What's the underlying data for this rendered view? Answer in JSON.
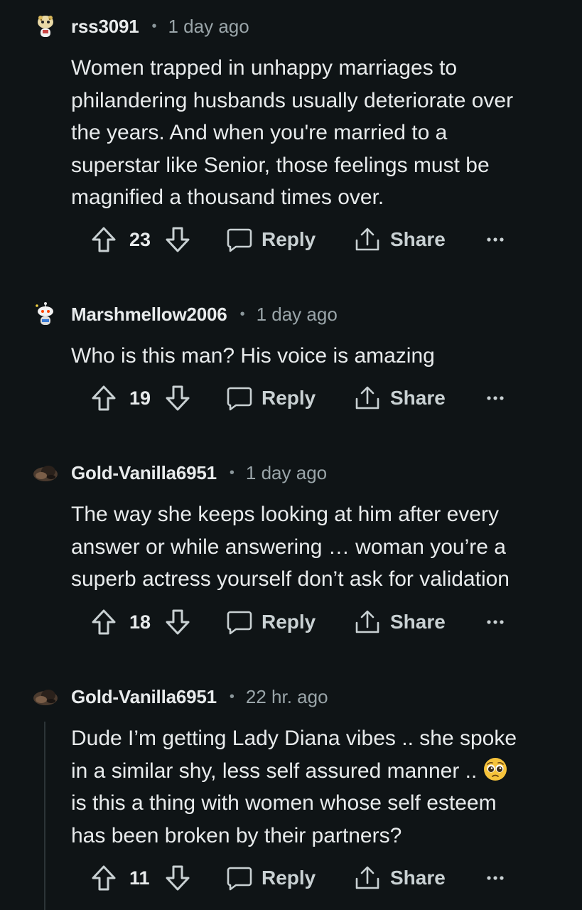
{
  "comments": [
    {
      "username": "rss3091",
      "separator": "•",
      "time": "1 day ago",
      "lines": [
        "Women trapped in unhappy marriages to",
        "philandering husbands usually deteriorate over",
        "the years. And when you're married to a",
        "superstar like Senior, those feelings must be",
        "magnified a thousand times over."
      ],
      "votes": "23",
      "reply_label": "Reply",
      "share_label": "Share",
      "avatar_icon": "snoo-leopard-avatar-icon"
    },
    {
      "username": "Marshmellow2006",
      "separator": "•",
      "time": "1 day ago",
      "lines": [
        "Who is this man? His voice is amazing"
      ],
      "votes": "19",
      "reply_label": "Reply",
      "share_label": "Share",
      "avatar_icon": "snoo-antenna-avatar-icon"
    },
    {
      "username": "Gold-Vanilla6951",
      "separator": "•",
      "time": "1 day ago",
      "lines": [
        "The way she keeps looking at him after every",
        "answer or while answering … woman you’re a",
        "superb actress yourself don’t ask for validation"
      ],
      "votes": "18",
      "reply_label": "Reply",
      "share_label": "Share",
      "avatar_icon": "user-photo-avatar-icon"
    },
    {
      "username": "Gold-Vanilla6951",
      "separator": "•",
      "time": "22 hr. ago",
      "lines": [
        "Dude I’m getting Lady Diana vibes .. she spoke",
        "in a similar shy, less self assured manner ..",
        "is this a thing with women whose self esteem",
        "has been broken by their partners?"
      ],
      "votes": "11",
      "reply_label": "Reply",
      "share_label": "Share",
      "avatar_icon": "user-photo-avatar-icon",
      "emoji": "pleading-face-emoji"
    }
  ],
  "colors": {
    "background": "#0f1416",
    "text": "#e8ebec",
    "meta": "#9aa5a9",
    "action": "#c9d1d3",
    "thread_line": "#2c3437"
  }
}
